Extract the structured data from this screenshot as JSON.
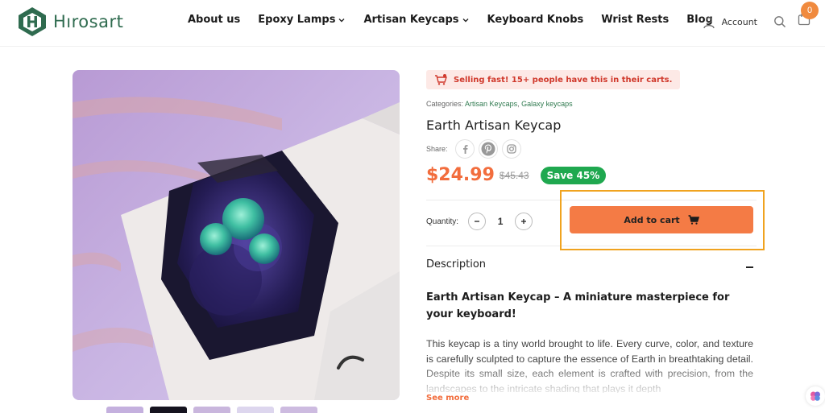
{
  "brand": {
    "name": "Hırosart",
    "color": "#2f6b4f"
  },
  "nav": {
    "items": [
      {
        "label": "About us",
        "has_dropdown": false
      },
      {
        "label": "Epoxy Lamps",
        "has_dropdown": true
      },
      {
        "label": "Artisan Keycaps",
        "has_dropdown": true
      },
      {
        "label": "Keyboard Knobs",
        "has_dropdown": false
      },
      {
        "label": "Wrist Rests",
        "has_dropdown": false
      },
      {
        "label": "Blog",
        "has_dropdown": false
      }
    ]
  },
  "header": {
    "account_label": "Account",
    "cart_count": "0",
    "icons": [
      "user-icon",
      "search-icon",
      "shopping-bag-icon"
    ]
  },
  "product": {
    "urgency_text": "Selling fast!  15+ people have this in their carts.",
    "categories_label": "Categories:",
    "categories": [
      "Artisan Keycaps",
      "Galaxy keycaps"
    ],
    "title": "Earth Artisan Keycap",
    "share_label": "Share:",
    "share_icons": [
      "facebook-icon",
      "pinterest-icon",
      "instagram-icon"
    ],
    "price": "$24.99",
    "old_price": "$45.43",
    "save_badge": "Save 45%",
    "quantity_label": "Quantity:",
    "quantity": "1",
    "add_to_cart": "Add to cart",
    "description_title": "Description",
    "description_headline": "Earth Artisan Keycap – A miniature masterpiece for your keyboard!",
    "description_body": "This keycap is a tiny world brought to life. Every curve, color, and texture is carefully sculpted to capture the essence of Earth in breathtaking detail. Despite its small size, each element is crafted with precision, from the landscapes to the intricate shading that plays it depth",
    "see_more": "See more"
  },
  "colors": {
    "accent": "#f47b45",
    "price": "#f26d3d",
    "save_badge": "#1fa84f",
    "highlight": "#f0a31f",
    "urgency_bg": "#fde9e6",
    "urgency_text": "#d0392c"
  }
}
